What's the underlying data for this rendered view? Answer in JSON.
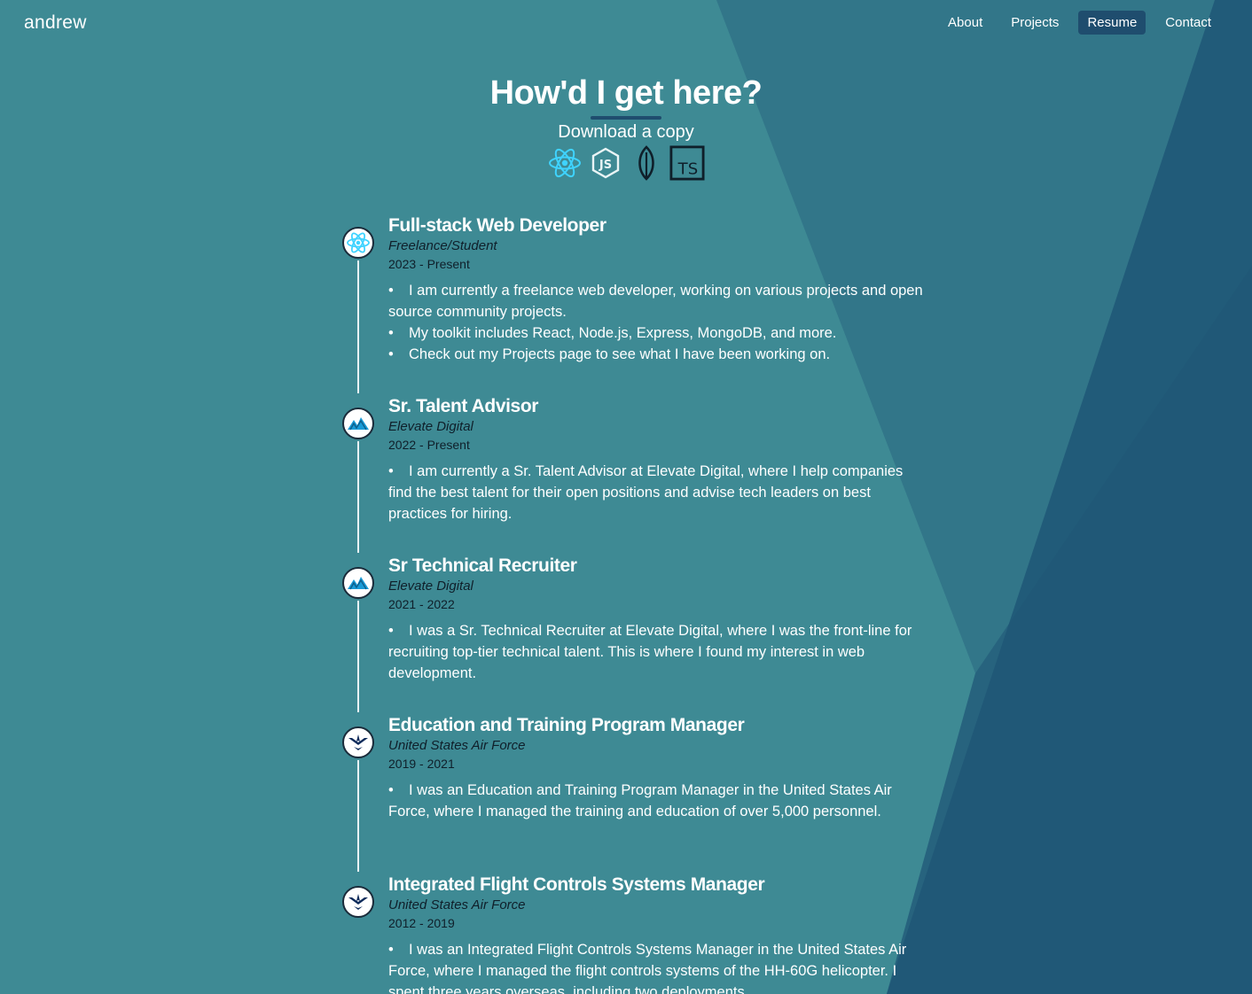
{
  "brand": "andrew",
  "nav": {
    "items": [
      {
        "label": "About",
        "active": false
      },
      {
        "label": "Projects",
        "active": false
      },
      {
        "label": "Resume",
        "active": true
      },
      {
        "label": "Contact",
        "active": false
      }
    ]
  },
  "hero": {
    "title": "How'd I get here?",
    "download_label": "Download a copy",
    "tech_icons": [
      "react-icon",
      "nodejs-icon",
      "mongodb-icon",
      "typescript-icon"
    ]
  },
  "colors": {
    "background": "#3e8a94",
    "accent_dark": "#1f4d6e",
    "text_dark": "#0f1f2a"
  },
  "timeline": [
    {
      "title": "Full-stack Web Developer",
      "company": "Freelance/Student",
      "dates": "2023 - Present",
      "icon": "react-icon",
      "bullets": [
        "I am currently a freelance web developer, working on various projects and open source community projects.",
        "My toolkit includes React, Node.js, Express, MongoDB, and more.",
        "Check out my Projects page to see what I have been working on."
      ]
    },
    {
      "title": "Sr. Talent Advisor",
      "company": "Elevate Digital",
      "dates": "2022 - Present",
      "icon": "elevate-digital-icon",
      "bullets": [
        "I am currently a Sr. Talent Advisor at Elevate Digital, where I help companies find the best talent for their open positions and advise tech leaders on best practices for hiring."
      ]
    },
    {
      "title": "Sr Technical Recruiter",
      "company": "Elevate Digital",
      "dates": "2021 - 2022",
      "icon": "elevate-digital-icon",
      "bullets": [
        "I was a Sr. Technical Recruiter at Elevate Digital, where I was the front-line for recruiting top-tier technical talent. This is where I found my interest in web development."
      ]
    },
    {
      "title": "Education and Training Program Manager",
      "company": "United States Air Force",
      "dates": "2019 - 2021",
      "icon": "air-force-icon",
      "bullets": [
        "I was an Education and Training Program Manager in the United States Air Force, where I managed the training and education of over 5,000 personnel."
      ]
    },
    {
      "title": "Integrated Flight Controls Systems Manager",
      "company": "United States Air Force",
      "dates": "2012 - 2019",
      "icon": "air-force-icon",
      "bullets": [
        "I was an Integrated Flight Controls Systems Manager in the United States Air Force, where I managed the flight controls systems of the HH-60G helicopter. I spent three years overseas, including two deployments"
      ]
    }
  ]
}
